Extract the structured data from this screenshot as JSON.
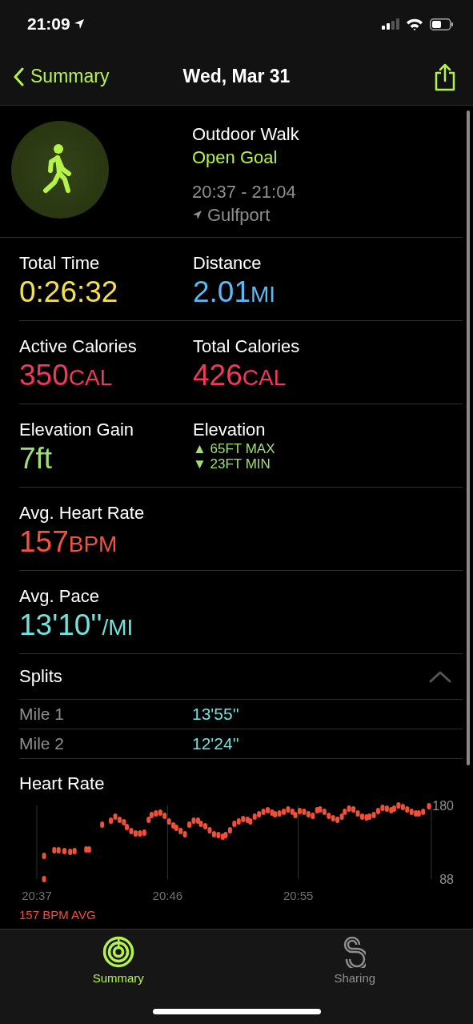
{
  "status_bar": {
    "time": "21:09"
  },
  "nav": {
    "back": "Summary",
    "title": "Wed, Mar 31"
  },
  "workout": {
    "name": "Outdoor Walk",
    "goal": "Open Goal",
    "time_range": "20:37 - 21:04",
    "location": "Gulfport"
  },
  "metrics": [
    [
      {
        "kind": "value",
        "label": "Total Time",
        "value": "0:26:32",
        "color": "#f4e04d"
      },
      {
        "kind": "value",
        "label": "Distance",
        "value": "2.01",
        "unit": "MI",
        "color": "#5ab8f5"
      }
    ],
    [
      {
        "kind": "value",
        "label": "Active Calories",
        "value": "350",
        "unit": "CAL",
        "color": "#f0385c"
      },
      {
        "kind": "value",
        "label": "Total Calories",
        "value": "426",
        "unit": "CAL",
        "color": "#f0385c"
      }
    ],
    [
      {
        "kind": "value",
        "label": "Elevation Gain",
        "value": "7ft",
        "color": "#9fe070"
      },
      {
        "kind": "range",
        "label": "Elevation",
        "lines": [
          "▲ 65FT MAX",
          "▼ 23FT MIN"
        ],
        "color": "#9fe070"
      }
    ],
    [
      {
        "kind": "value",
        "label": "Avg. Heart Rate",
        "value": "157",
        "unit": "BPM",
        "color": "#f4523a"
      }
    ],
    [
      {
        "kind": "value",
        "label": "Avg. Pace",
        "value": "13'10''",
        "unit": "/MI",
        "color": "#6fe3dc"
      }
    ]
  ],
  "splits": {
    "title": "Splits",
    "expanded": true,
    "rows": [
      {
        "label": "Mile 1",
        "pace": "13'55''"
      },
      {
        "label": "Mile 2",
        "pace": "12'24''"
      }
    ]
  },
  "heart_rate": {
    "average": "157 BPM AVG",
    "chart_data": {
      "type": "scatter",
      "title": "Heart Rate",
      "xlim": [
        1237,
        1264
      ],
      "ylim": [
        88,
        180
      ],
      "xticks": [
        {
          "value": 1237,
          "label": "20:37"
        },
        {
          "value": 1246,
          "label": "20:46"
        },
        {
          "value": 1255,
          "label": "20:55"
        }
      ],
      "yticks": [
        88,
        180
      ],
      "x": [
        1237.5,
        1237.5,
        1238.2,
        1238.5,
        1238.9,
        1239.3,
        1239.6,
        1240.4,
        1240.6,
        1241.5,
        1242.1,
        1242.4,
        1242.7,
        1243.0,
        1243.2,
        1243.5,
        1243.8,
        1244.1,
        1244.4,
        1244.7,
        1244.9,
        1245.2,
        1245.5,
        1245.8,
        1246.1,
        1246.4,
        1246.6,
        1246.9,
        1247.2,
        1247.5,
        1247.8,
        1248.1,
        1248.3,
        1248.6,
        1248.9,
        1249.2,
        1249.5,
        1249.8,
        1250.0,
        1250.3,
        1250.6,
        1250.9,
        1251.2,
        1251.5,
        1251.7,
        1252.0,
        1252.3,
        1252.6,
        1252.9,
        1253.2,
        1253.4,
        1253.7,
        1254.0,
        1254.3,
        1254.6,
        1254.8,
        1255.1,
        1255.4,
        1255.7,
        1256.0,
        1256.3,
        1256.5,
        1256.8,
        1257.1,
        1257.4,
        1257.7,
        1258.0,
        1258.2,
        1258.5,
        1258.8,
        1259.1,
        1259.4,
        1259.7,
        1259.9,
        1260.2,
        1260.5,
        1260.8,
        1261.1,
        1261.4,
        1261.6,
        1261.9,
        1262.2,
        1262.5,
        1262.8,
        1263.1,
        1263.3,
        1263.6,
        1264.0
      ],
      "series": [
        {
          "color": "#f0503a",
          "values": [
            88,
            117,
            124,
            124,
            123,
            122,
            123,
            125,
            125,
            156,
            161,
            166,
            162,
            159,
            153,
            148,
            145,
            145,
            146,
            162,
            168,
            170,
            171,
            167,
            160,
            155,
            152,
            148,
            144,
            156,
            161,
            161,
            157,
            154,
            149,
            144,
            143,
            141,
            143,
            149,
            157,
            160,
            163,
            162,
            160,
            166,
            169,
            172,
            174,
            171,
            169,
            170,
            172,
            175,
            172,
            168,
            173,
            172,
            169,
            167,
            174,
            175,
            172,
            167,
            164,
            162,
            166,
            172,
            176,
            175,
            170,
            166,
            165,
            166,
            168,
            173,
            177,
            176,
            174,
            176,
            180,
            178,
            175,
            172,
            170,
            170,
            172,
            179
          ]
        }
      ]
    }
  },
  "tabs": [
    {
      "label": "Summary",
      "selected": true
    },
    {
      "label": "Sharing",
      "selected": false
    }
  ]
}
